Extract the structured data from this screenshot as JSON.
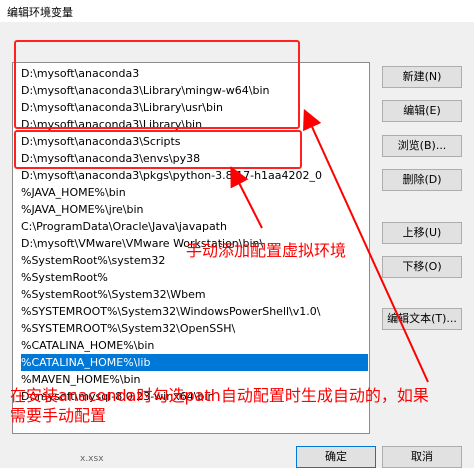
{
  "window": {
    "title": "编辑环境变量"
  },
  "paths": [
    "D:\\mysoft\\anaconda3",
    "D:\\mysoft\\anaconda3\\Library\\mingw-w64\\bin",
    "D:\\mysoft\\anaconda3\\Library\\usr\\bin",
    "D:\\mysoft\\anaconda3\\Library\\bin",
    "D:\\mysoft\\anaconda3\\Scripts",
    "D:\\mysoft\\anaconda3\\envs\\py38",
    "D:\\mysoft\\anaconda3\\pkgs\\python-3.8.17-h1aa4202_0",
    "%JAVA_HOME%\\bin",
    "%JAVA_HOME%\\jre\\bin",
    "C:\\ProgramData\\Oracle\\Java\\javapath",
    "D:\\mysoft\\VMware\\VMware Workstation\\bin\\",
    "%SystemRoot%\\system32",
    "%SystemRoot%",
    "%SystemRoot%\\System32\\Wbem",
    "%SYSTEMROOT%\\System32\\WindowsPowerShell\\v1.0\\",
    "%SYSTEMROOT%\\System32\\OpenSSH\\",
    "%CATALINA_HOME%\\bin",
    "%CATALINA_HOME%\\lib",
    "%MAVEN_HOME%\\bin",
    "D:\\mysoft\\mysql-8.0.23-winx64\\bin"
  ],
  "selected_index": 17,
  "buttons": {
    "new": "新建(N)",
    "edit": "编辑(E)",
    "browse": "浏览(B)...",
    "delete": "删除(D)",
    "move_up": "上移(U)",
    "move_down": "下移(O)",
    "edit_text": "编辑文本(T)...",
    "ok": "确定",
    "cancel": "取消"
  },
  "annotations": {
    "manual_config": "手动添加配置虚拟环境",
    "note_line1": "在安装anaconda时勾选path自动配置时生成自动的，如果",
    "note_line2": "需要手动配置"
  },
  "colors": {
    "selection": "#0078d7",
    "annotation_red": "#ff0000"
  },
  "taskbar": {
    "fragment": "x.xsx"
  }
}
